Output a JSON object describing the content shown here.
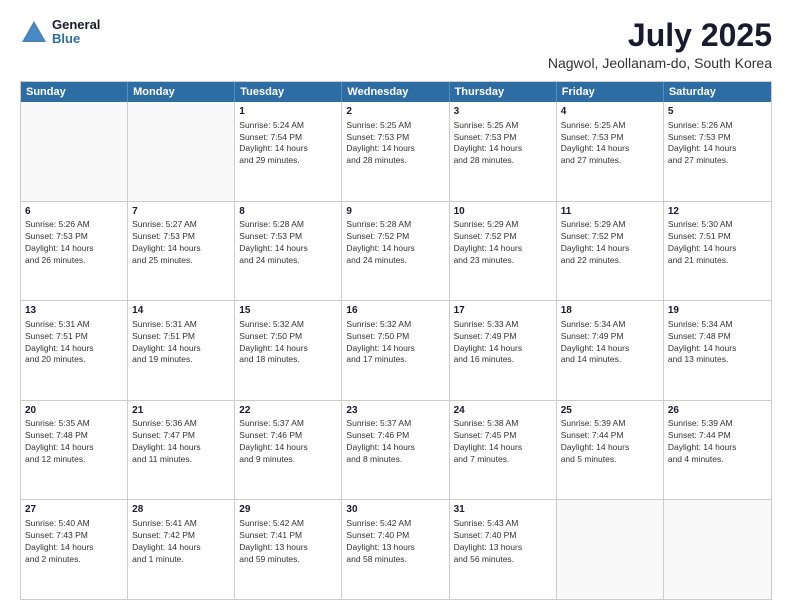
{
  "header": {
    "logo": {
      "line1": "General",
      "line2": "Blue"
    },
    "title": "July 2025",
    "location": "Nagwol, Jeollanam-do, South Korea"
  },
  "calendar": {
    "headers": [
      "Sunday",
      "Monday",
      "Tuesday",
      "Wednesday",
      "Thursday",
      "Friday",
      "Saturday"
    ],
    "rows": [
      [
        {
          "day": "",
          "empty": true
        },
        {
          "day": "",
          "empty": true
        },
        {
          "day": "1",
          "line1": "Sunrise: 5:24 AM",
          "line2": "Sunset: 7:54 PM",
          "line3": "Daylight: 14 hours",
          "line4": "and 29 minutes."
        },
        {
          "day": "2",
          "line1": "Sunrise: 5:25 AM",
          "line2": "Sunset: 7:53 PM",
          "line3": "Daylight: 14 hours",
          "line4": "and 28 minutes."
        },
        {
          "day": "3",
          "line1": "Sunrise: 5:25 AM",
          "line2": "Sunset: 7:53 PM",
          "line3": "Daylight: 14 hours",
          "line4": "and 28 minutes."
        },
        {
          "day": "4",
          "line1": "Sunrise: 5:25 AM",
          "line2": "Sunset: 7:53 PM",
          "line3": "Daylight: 14 hours",
          "line4": "and 27 minutes."
        },
        {
          "day": "5",
          "line1": "Sunrise: 5:26 AM",
          "line2": "Sunset: 7:53 PM",
          "line3": "Daylight: 14 hours",
          "line4": "and 27 minutes."
        }
      ],
      [
        {
          "day": "6",
          "line1": "Sunrise: 5:26 AM",
          "line2": "Sunset: 7:53 PM",
          "line3": "Daylight: 14 hours",
          "line4": "and 26 minutes."
        },
        {
          "day": "7",
          "line1": "Sunrise: 5:27 AM",
          "line2": "Sunset: 7:53 PM",
          "line3": "Daylight: 14 hours",
          "line4": "and 25 minutes."
        },
        {
          "day": "8",
          "line1": "Sunrise: 5:28 AM",
          "line2": "Sunset: 7:53 PM",
          "line3": "Daylight: 14 hours",
          "line4": "and 24 minutes."
        },
        {
          "day": "9",
          "line1": "Sunrise: 5:28 AM",
          "line2": "Sunset: 7:52 PM",
          "line3": "Daylight: 14 hours",
          "line4": "and 24 minutes."
        },
        {
          "day": "10",
          "line1": "Sunrise: 5:29 AM",
          "line2": "Sunset: 7:52 PM",
          "line3": "Daylight: 14 hours",
          "line4": "and 23 minutes."
        },
        {
          "day": "11",
          "line1": "Sunrise: 5:29 AM",
          "line2": "Sunset: 7:52 PM",
          "line3": "Daylight: 14 hours",
          "line4": "and 22 minutes."
        },
        {
          "day": "12",
          "line1": "Sunrise: 5:30 AM",
          "line2": "Sunset: 7:51 PM",
          "line3": "Daylight: 14 hours",
          "line4": "and 21 minutes."
        }
      ],
      [
        {
          "day": "13",
          "line1": "Sunrise: 5:31 AM",
          "line2": "Sunset: 7:51 PM",
          "line3": "Daylight: 14 hours",
          "line4": "and 20 minutes."
        },
        {
          "day": "14",
          "line1": "Sunrise: 5:31 AM",
          "line2": "Sunset: 7:51 PM",
          "line3": "Daylight: 14 hours",
          "line4": "and 19 minutes."
        },
        {
          "day": "15",
          "line1": "Sunrise: 5:32 AM",
          "line2": "Sunset: 7:50 PM",
          "line3": "Daylight: 14 hours",
          "line4": "and 18 minutes."
        },
        {
          "day": "16",
          "line1": "Sunrise: 5:32 AM",
          "line2": "Sunset: 7:50 PM",
          "line3": "Daylight: 14 hours",
          "line4": "and 17 minutes."
        },
        {
          "day": "17",
          "line1": "Sunrise: 5:33 AM",
          "line2": "Sunset: 7:49 PM",
          "line3": "Daylight: 14 hours",
          "line4": "and 16 minutes."
        },
        {
          "day": "18",
          "line1": "Sunrise: 5:34 AM",
          "line2": "Sunset: 7:49 PM",
          "line3": "Daylight: 14 hours",
          "line4": "and 14 minutes."
        },
        {
          "day": "19",
          "line1": "Sunrise: 5:34 AM",
          "line2": "Sunset: 7:48 PM",
          "line3": "Daylight: 14 hours",
          "line4": "and 13 minutes."
        }
      ],
      [
        {
          "day": "20",
          "line1": "Sunrise: 5:35 AM",
          "line2": "Sunset: 7:48 PM",
          "line3": "Daylight: 14 hours",
          "line4": "and 12 minutes."
        },
        {
          "day": "21",
          "line1": "Sunrise: 5:36 AM",
          "line2": "Sunset: 7:47 PM",
          "line3": "Daylight: 14 hours",
          "line4": "and 11 minutes."
        },
        {
          "day": "22",
          "line1": "Sunrise: 5:37 AM",
          "line2": "Sunset: 7:46 PM",
          "line3": "Daylight: 14 hours",
          "line4": "and 9 minutes."
        },
        {
          "day": "23",
          "line1": "Sunrise: 5:37 AM",
          "line2": "Sunset: 7:46 PM",
          "line3": "Daylight: 14 hours",
          "line4": "and 8 minutes."
        },
        {
          "day": "24",
          "line1": "Sunrise: 5:38 AM",
          "line2": "Sunset: 7:45 PM",
          "line3": "Daylight: 14 hours",
          "line4": "and 7 minutes."
        },
        {
          "day": "25",
          "line1": "Sunrise: 5:39 AM",
          "line2": "Sunset: 7:44 PM",
          "line3": "Daylight: 14 hours",
          "line4": "and 5 minutes."
        },
        {
          "day": "26",
          "line1": "Sunrise: 5:39 AM",
          "line2": "Sunset: 7:44 PM",
          "line3": "Daylight: 14 hours",
          "line4": "and 4 minutes."
        }
      ],
      [
        {
          "day": "27",
          "line1": "Sunrise: 5:40 AM",
          "line2": "Sunset: 7:43 PM",
          "line3": "Daylight: 14 hours",
          "line4": "and 2 minutes."
        },
        {
          "day": "28",
          "line1": "Sunrise: 5:41 AM",
          "line2": "Sunset: 7:42 PM",
          "line3": "Daylight: 14 hours",
          "line4": "and 1 minute."
        },
        {
          "day": "29",
          "line1": "Sunrise: 5:42 AM",
          "line2": "Sunset: 7:41 PM",
          "line3": "Daylight: 13 hours",
          "line4": "and 59 minutes."
        },
        {
          "day": "30",
          "line1": "Sunrise: 5:42 AM",
          "line2": "Sunset: 7:40 PM",
          "line3": "Daylight: 13 hours",
          "line4": "and 58 minutes."
        },
        {
          "day": "31",
          "line1": "Sunrise: 5:43 AM",
          "line2": "Sunset: 7:40 PM",
          "line3": "Daylight: 13 hours",
          "line4": "and 56 minutes."
        },
        {
          "day": "",
          "empty": true
        },
        {
          "day": "",
          "empty": true
        }
      ]
    ]
  }
}
